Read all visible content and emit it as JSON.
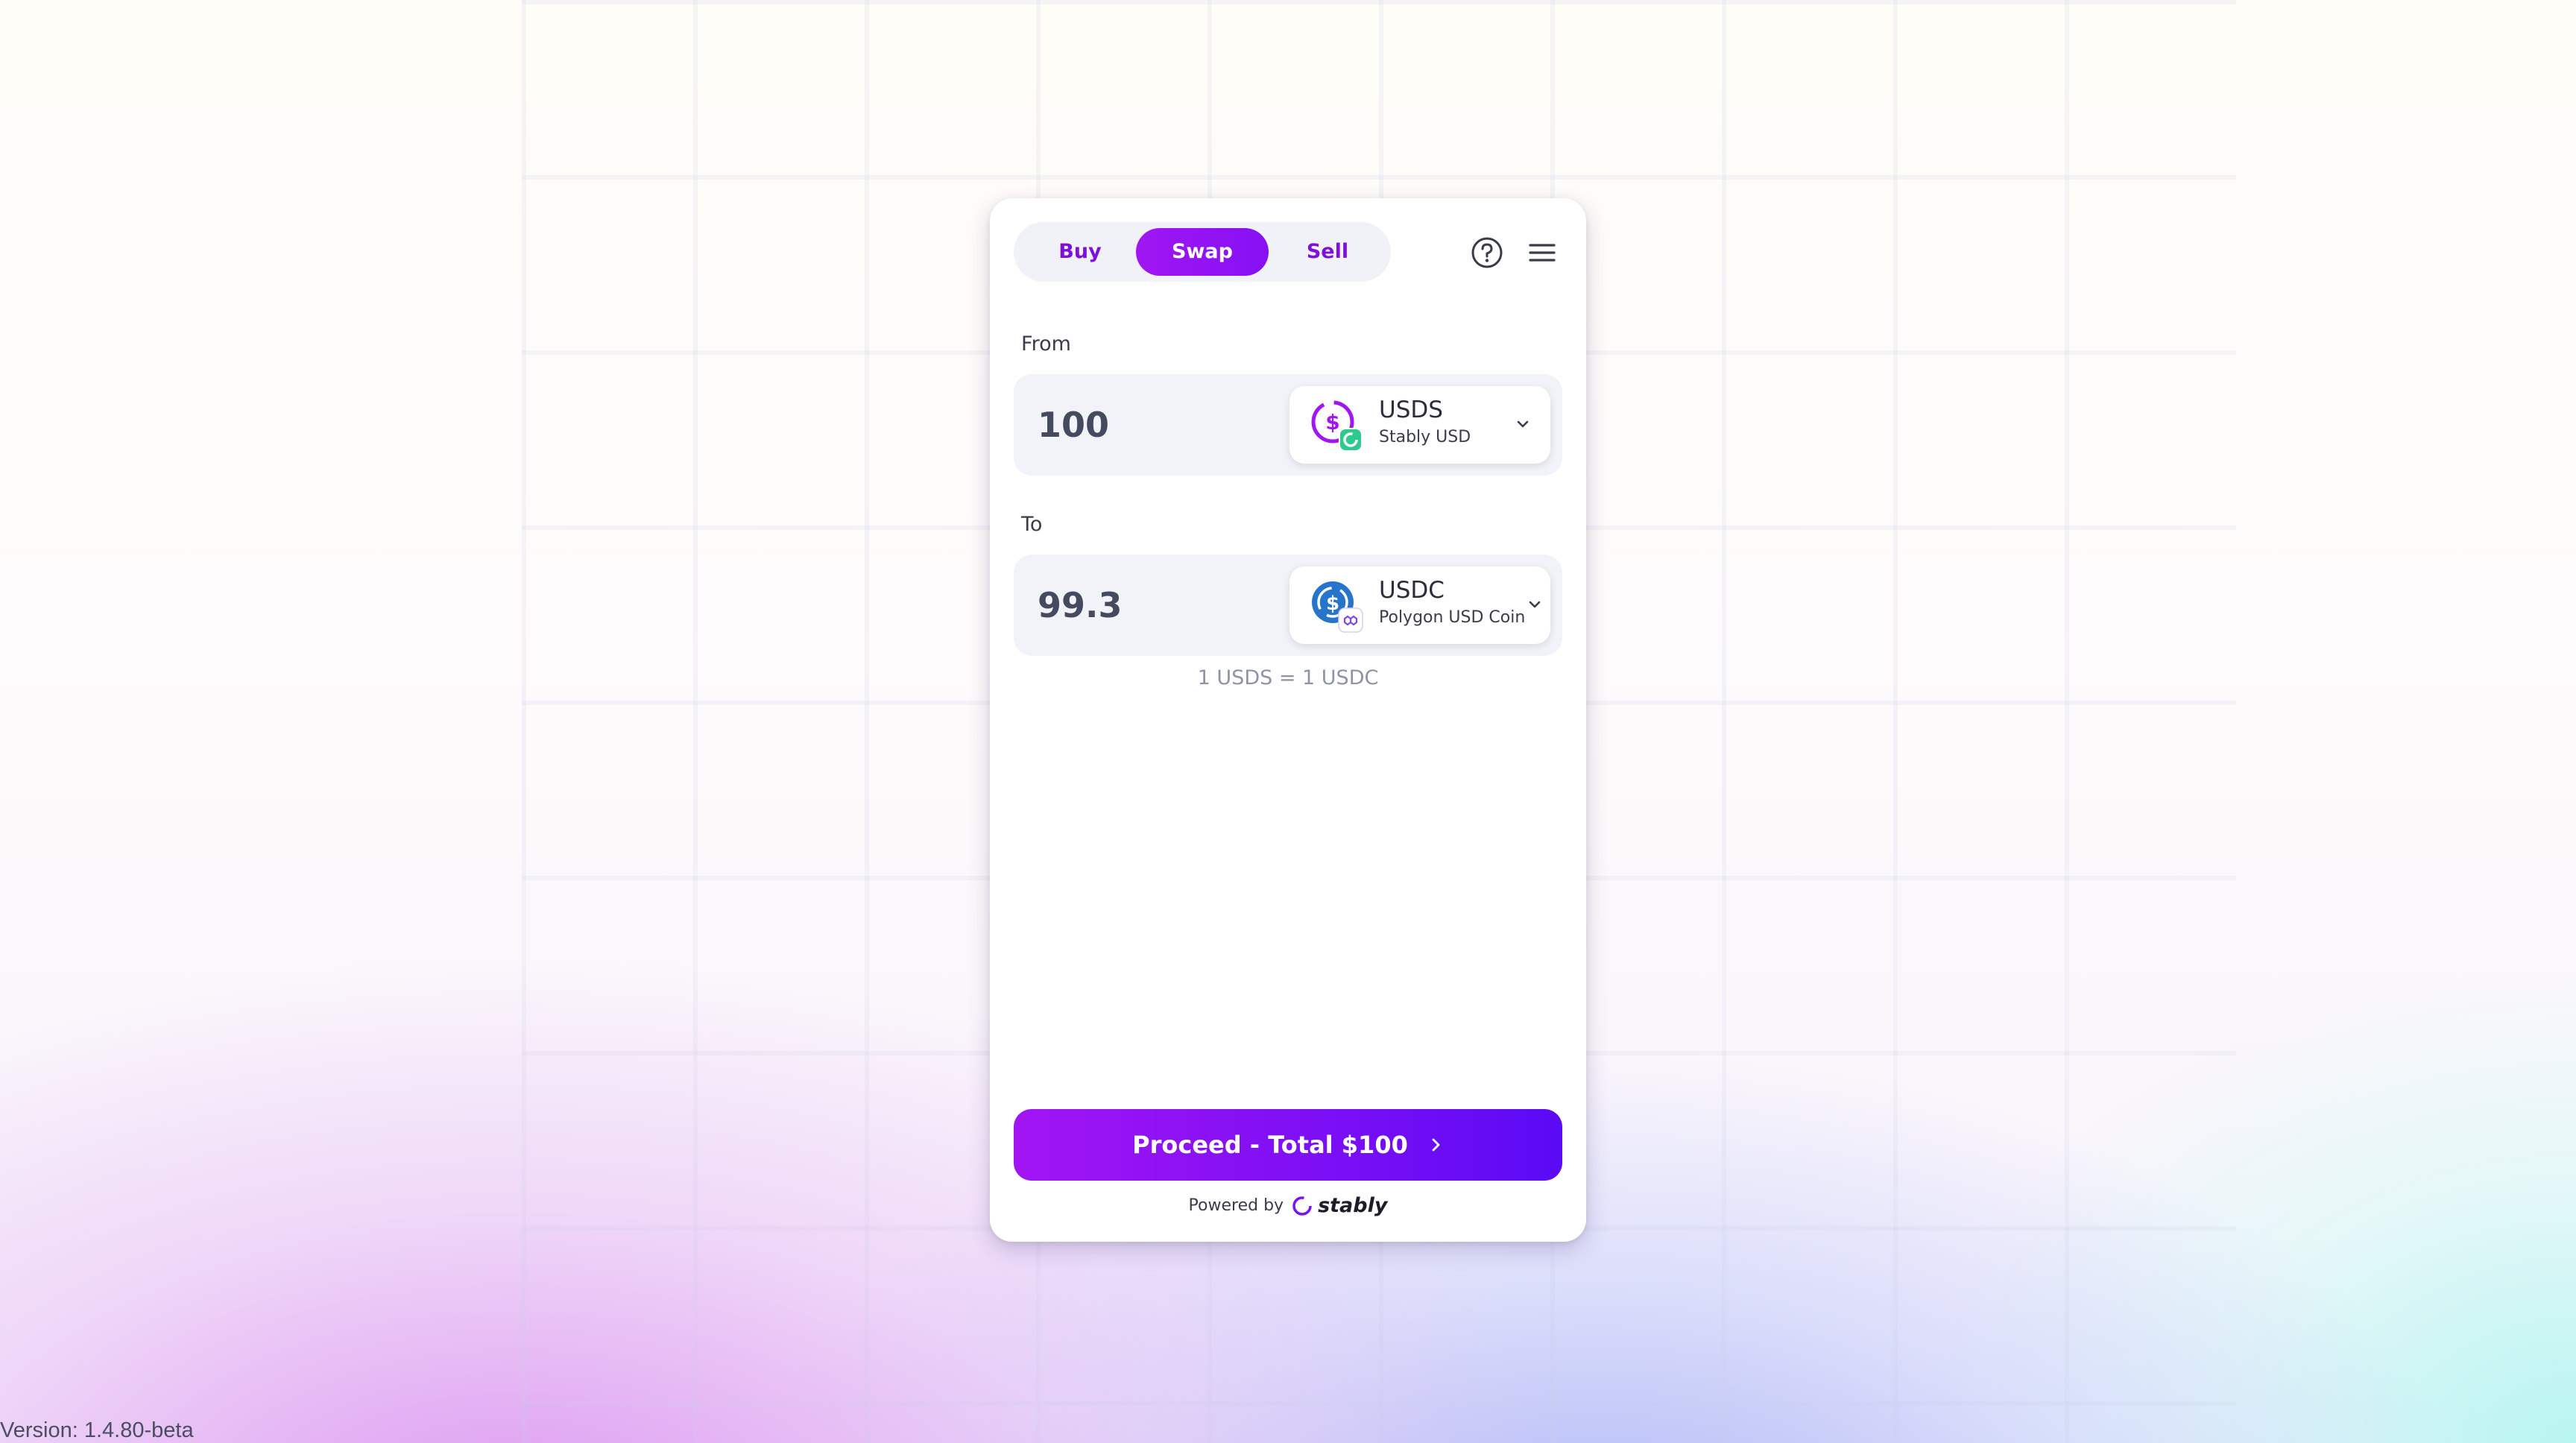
{
  "tabs": [
    {
      "label": "Buy",
      "active": false
    },
    {
      "label": "Swap",
      "active": true
    },
    {
      "label": "Sell",
      "active": false
    }
  ],
  "header_icons": [
    "help-icon",
    "menu-icon"
  ],
  "from": {
    "label": "From",
    "amount": "100",
    "token_symbol": "USDS",
    "token_name": "Stably USD",
    "icon": "stably-usd-icon"
  },
  "to": {
    "label": "To",
    "amount": "99.3",
    "token_symbol": "USDC",
    "token_name": "Polygon USD Coin",
    "icon": "usdc-polygon-icon"
  },
  "rate": "1 USDS = 1 USDC",
  "proceed": {
    "label": "Proceed - Total $100"
  },
  "powered_by": {
    "prefix": "Powered by",
    "brand": "stably"
  },
  "version": "Version: 1.4.80-beta",
  "colors": {
    "accent": "#8a10f4",
    "accent_dark": "#5a0af5",
    "field_bg": "#f1f3f8",
    "usds_green": "#2ec98f",
    "usdc_blue": "#2775ca"
  }
}
